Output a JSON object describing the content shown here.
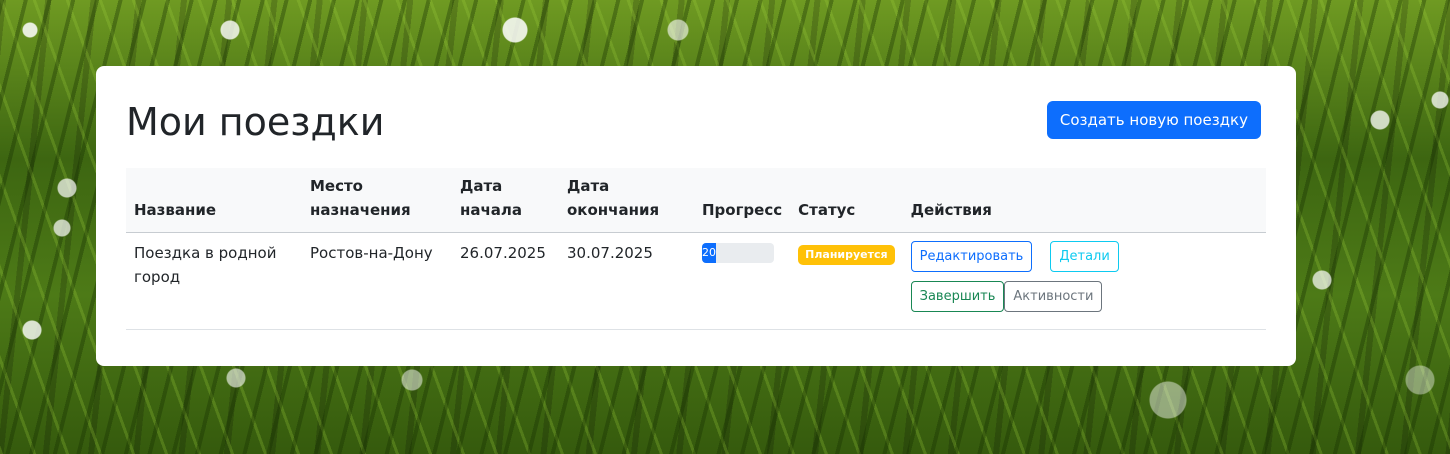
{
  "page": {
    "title": "Мои поездки",
    "create_button": "Создать новую поездку"
  },
  "table": {
    "columns": {
      "name": "Название",
      "destination": "Место назначения",
      "start_date": "Дата начала",
      "end_date": "Дата окончания",
      "progress": "Прогресс",
      "status": "Статус",
      "actions": "Действия"
    },
    "rows": [
      {
        "name": "Поездка в родной город",
        "destination": "Ростов-на-Дону",
        "start_date": "26.07.2025",
        "end_date": "30.07.2025",
        "progress_label": "20",
        "progress_percent": 20,
        "status": "Планируется",
        "actions": {
          "edit": "Редактировать",
          "details": "Детали",
          "finish": "Завершить",
          "activities": "Активности"
        }
      }
    ]
  },
  "colors": {
    "primary": "#0d6efd",
    "info": "#0dcaf0",
    "success": "#198754",
    "secondary": "#6c757d",
    "warning": "#ffc107"
  }
}
